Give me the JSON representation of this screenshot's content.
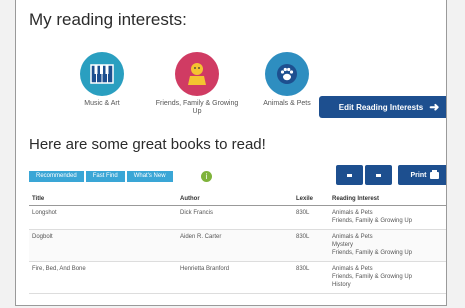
{
  "section1": {
    "heading": "My reading interests:"
  },
  "interests": [
    {
      "label": "Music & Art",
      "icon": "piano-icon",
      "color": "#2a9fc0"
    },
    {
      "label": "Friends, Family & Growing Up",
      "icon": "child-icon",
      "color": "#d03b63"
    },
    {
      "label": "Animals & Pets",
      "icon": "paw-icon",
      "color": "#2e8ec0"
    }
  ],
  "edit_button": {
    "label": "Edit Reading Interests",
    "icon": "arrow-right-icon"
  },
  "section2": {
    "heading": "Here are some great books to read!"
  },
  "tabs": [
    "Recommended",
    "Fast Find",
    "What's New"
  ],
  "info_icon": "i",
  "print_button": {
    "label": "Print",
    "icon": "printer-icon"
  },
  "table": {
    "headers": [
      "Title",
      "Author",
      "Lexile",
      "Reading Interest"
    ],
    "rows": [
      {
        "title": "Longshot",
        "author": "Dick Francis",
        "lexile": "830L",
        "interests": [
          "Animals & Pets",
          "Friends, Family & Growing Up"
        ]
      },
      {
        "title": "Dogbolt",
        "author": "Aiden R. Carter",
        "lexile": "830L",
        "interests": [
          "Animals & Pets",
          "Mystery",
          "Friends, Family & Growing Up"
        ]
      },
      {
        "title": "Fire, Bed, And Bone",
        "author": "Henrietta Branford",
        "lexile": "830L",
        "interests": [
          "Animals & Pets",
          "Friends, Family & Growing Up",
          "History"
        ]
      }
    ]
  }
}
